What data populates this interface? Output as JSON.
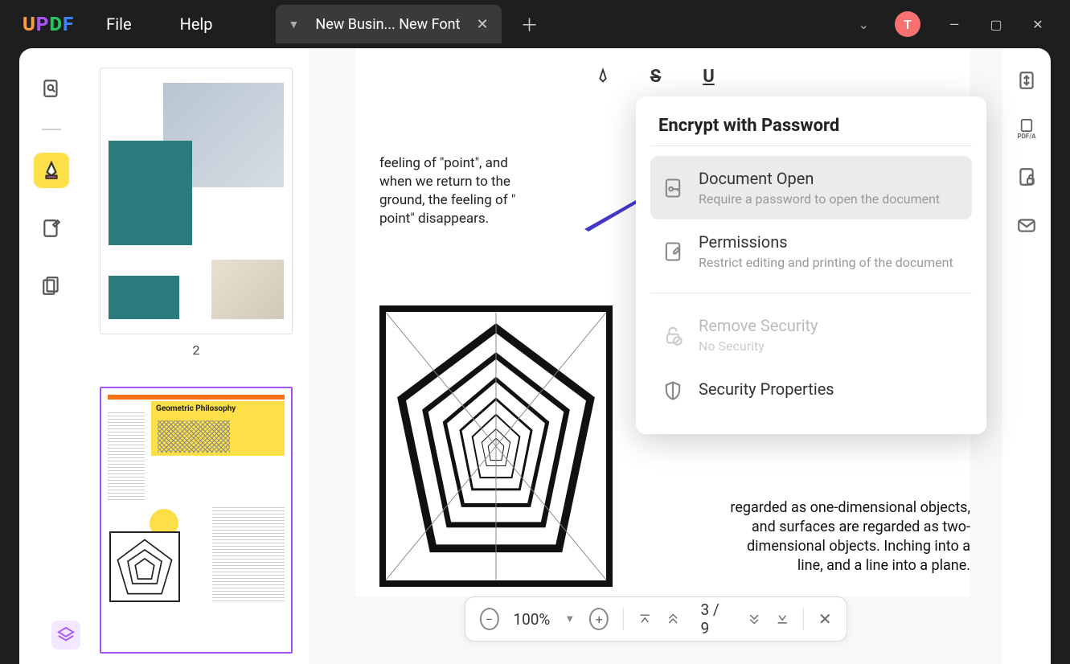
{
  "app": {
    "logo": "UPDF",
    "menu": {
      "file": "File",
      "help": "Help"
    },
    "tab_title": "New Busin... New Font",
    "avatar_initial": "T"
  },
  "thumbs": {
    "page2_label": "2",
    "page3_title": "Geometric Philosophy"
  },
  "doc": {
    "text1": "feeling of \"point\", and when we return to the ground, the feeling of \" point\" disappears.",
    "text2": "regarded as one-dimensional objects, and surfaces are regarded as two-dimensional objects. Inching into a line, and a line into a plane."
  },
  "pagination": {
    "zoom": "100%",
    "page": "3  /  9"
  },
  "security": {
    "title": "Encrypt with Password",
    "open": {
      "title": "Document Open",
      "sub": "Require a password to open the document"
    },
    "perm": {
      "title": "Permissions",
      "sub": "Restrict editing and printing of the document"
    },
    "remove": {
      "title": "Remove Security",
      "sub": "No Security"
    },
    "props": {
      "title": "Security Properties"
    }
  }
}
